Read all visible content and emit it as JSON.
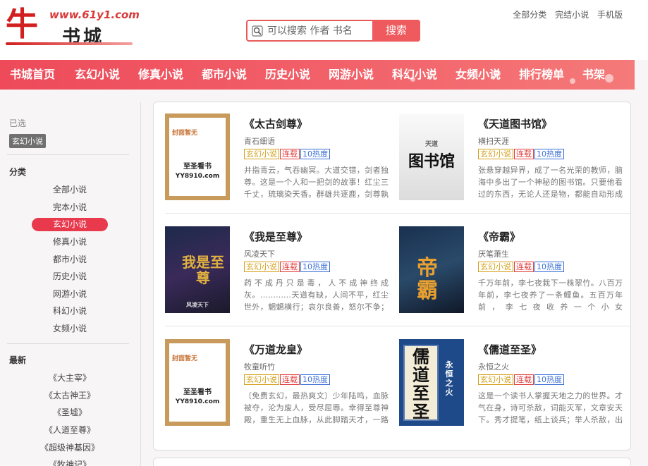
{
  "header": {
    "logo_main": "牛",
    "logo_sub": "书城",
    "logo_url": "www.61y1.com",
    "search_placeholder": "可以搜索 作者 书名",
    "search_button": "搜索",
    "top_links": [
      "全部分类",
      "完结小说",
      "手机版"
    ]
  },
  "nav": {
    "items": [
      "书城首页",
      "玄幻小说",
      "修真小说",
      "都市小说",
      "历史小说",
      "网游小说",
      "科幻小说",
      "女频小说",
      "排行榜单",
      "书架"
    ]
  },
  "sidebar": {
    "selected_label": "已选",
    "selected_tag": "玄幻小说",
    "category_head": "分类",
    "categories": [
      "全部小说",
      "完本小说",
      "玄幻小说",
      "修真小说",
      "都市小说",
      "历史小说",
      "网游小说",
      "科幻小说",
      "女频小说"
    ],
    "active_category": "玄幻小说",
    "latest_head": "最新",
    "latest": [
      "《大主宰》",
      "《太古神王》",
      "《圣墟》",
      "《人道至尊》",
      "《超级神基因》",
      "《牧神记》"
    ]
  },
  "books": [
    {
      "title": "《太古剑尊》",
      "author": "青石细语",
      "genre": "玄幻小说",
      "status": "连载",
      "heat": "10热度",
      "desc": "并指青云，气吞幽冥。大道交错，剑者独尊。这是一个人和一把剑的故事！红尘三千丈，琉璃染天香。群雄共逐鹿，剑尊孰苍",
      "cover": "placeholder",
      "cover_text": [
        "至圣看书",
        "YY8910.com"
      ],
      "cover_badge": "封面暂无"
    },
    {
      "title": "《天道图书馆》",
      "author": "横扫天涯",
      "genre": "玄幻小说",
      "status": "连载",
      "heat": "10热度",
      "desc": "张悬穿越异界，成了一名光荣的教师，脑海中多出了一个神秘的图书馆。只要他看过的东西，无论人还是物，都能自动形成书籍，",
      "cover": "light",
      "cover_text": [
        "图书馆"
      ],
      "cover_badge": "天道"
    },
    {
      "title": "《我是至尊》",
      "author": "风凌天下",
      "genre": "玄幻小说",
      "status": "连载",
      "heat": "10热度",
      "desc": "药不成丹只是毒，人不成神终成灰。…………天道有缺，人间不平，红尘世外，魍魉横行；哀尔良善，怒尔不争；规则",
      "cover": "dark",
      "cover_text": [
        "我是至尊"
      ],
      "cover_badge": "风凌天下"
    },
    {
      "title": "《帝霸》",
      "author": "厌笔萧生",
      "genre": "玄幻小说",
      "status": "连载",
      "heat": "10热度",
      "desc": "千万年前，李七夜栽下一株翠竹。八百万年前，李七夜养了一条鲤鱼。五百万年前，李七夜收养一个小女孩。…………………………今",
      "cover": "dark",
      "cover_text": [
        "帝霸"
      ],
      "cover_badge": ""
    },
    {
      "title": "《万道龙皇》",
      "author": "牧童听竹",
      "genre": "玄幻小说",
      "status": "连载",
      "heat": "10热度",
      "desc": "〔免费玄幻，最热爽文〕少年陆鸣，血脉被夺，沦为废人，受尽屈辱。幸得至尊神殿，重生无上血脉，从此脚踏天才，一路逆袭，",
      "cover": "placeholder",
      "cover_text": [
        "至圣看书",
        "YY8910.com"
      ],
      "cover_badge": "封面暂无"
    },
    {
      "title": "《儒道至圣》",
      "author": "永恒之火",
      "genre": "玄幻小说",
      "status": "连载",
      "heat": "10热度",
      "desc": "这是一个读书人掌握天地之力的世界。才气在身，诗可杀敌，词能灭军，文章安天下。秀才提笔，纸上谈兵；举人杀敌，出口成",
      "cover": "blue",
      "cover_text": [
        "儒道至圣"
      ],
      "cover_badge": "永恒之火"
    }
  ]
}
